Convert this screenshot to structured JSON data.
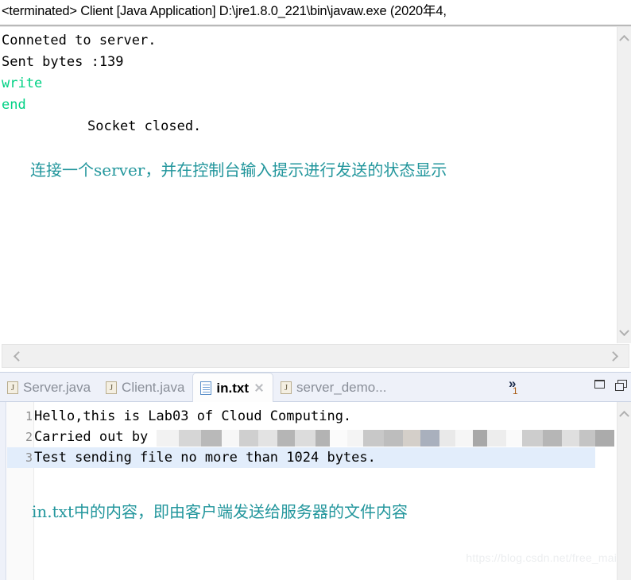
{
  "console": {
    "title": "<terminated> Client [Java Application] D:\\jre1.8.0_221\\bin\\javaw.exe (2020年4,",
    "lines": [
      {
        "text": "Conneted to server.",
        "color": "black",
        "indent": false
      },
      {
        "text": "Sent bytes :139",
        "color": "black",
        "indent": false
      },
      {
        "text": "write",
        "color": "green",
        "indent": false
      },
      {
        "text": "end",
        "color": "green",
        "indent": false
      },
      {
        "text": "Socket closed.",
        "color": "black",
        "indent": true
      }
    ],
    "annotation": "连接一个server，并在控制台输入提示进行发送的状态显示",
    "scroll_up_icon": "chevron-up-icon",
    "scroll_down_icon": "chevron-down-icon",
    "scroll_left_icon": "chevron-left-icon",
    "scroll_right_icon": "chevron-right-icon"
  },
  "editor": {
    "tabs": [
      {
        "label": "Server.java",
        "icon": "java-file-icon",
        "active": false,
        "closable": false
      },
      {
        "label": "Client.java",
        "icon": "java-file-icon",
        "active": false,
        "closable": false
      },
      {
        "label": "in.txt",
        "icon": "text-file-icon",
        "active": true,
        "closable": true
      },
      {
        "label": "server_demo...",
        "icon": "java-file-icon",
        "active": false,
        "closable": false
      }
    ],
    "overflow": {
      "chevron": "»",
      "count": "1"
    },
    "window_buttons": [
      {
        "name": "minimize-button",
        "icon": "minimize-icon"
      },
      {
        "name": "maximize-button",
        "icon": "restore-icon"
      }
    ],
    "lines": [
      {
        "number": "1",
        "text": "Hello,this is Lab03 of Cloud Computing.",
        "redacted": false,
        "current": false
      },
      {
        "number": "2",
        "text": "Carried out by ",
        "redacted": true,
        "current": false
      },
      {
        "number": "3",
        "text": "Test sending file no more than 1024 bytes.",
        "redacted": false,
        "current": true
      }
    ],
    "annotation": "in.txt中的内容，即由客户端发送给服务器的文件内容",
    "scroll_up_icon": "chevron-up-icon"
  },
  "watermark": "https://blog.csdn.net/free_main",
  "colors": {
    "console_green": "#00d184",
    "annotation_teal": "#22969c",
    "current_line": "#e2edfb",
    "tabbar_bg": "#eef1f9",
    "overflow_count": "#a85a12"
  }
}
